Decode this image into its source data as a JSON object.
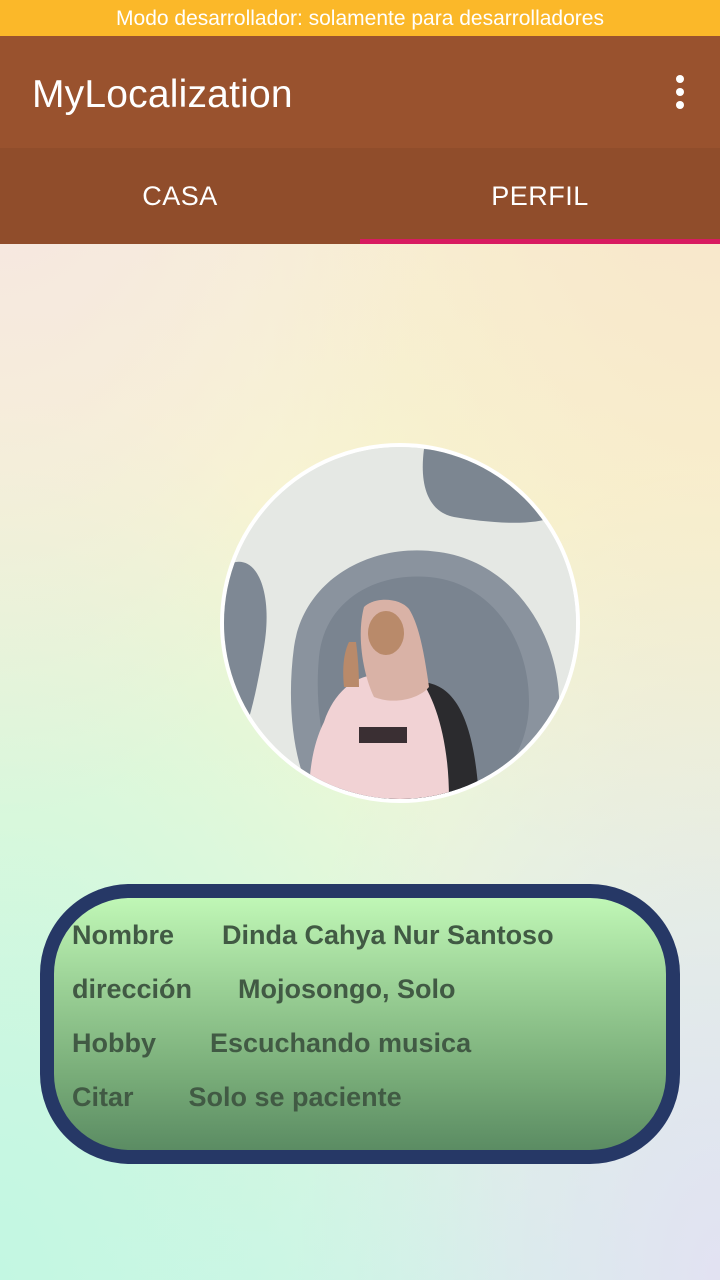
{
  "status_banner": "Modo desarrollador: solamente para desarrolladores",
  "appbar": {
    "title": "MyLocalization",
    "menu_icon": "more-vert-icon"
  },
  "tabs": [
    {
      "label": "CASA",
      "selected": false
    },
    {
      "label": "PERFIL",
      "selected": true
    }
  ],
  "profile": {
    "photo": "profile-photo",
    "rows": [
      {
        "label": "Nombre",
        "value": "Dinda Cahya Nur Santoso"
      },
      {
        "label": "dirección",
        "value": "Mojosongo, Solo"
      },
      {
        "label": "Hobby",
        "value": "Escuchando musica"
      },
      {
        "label": "Citar",
        "value": "Solo se paciente"
      }
    ]
  },
  "colors": {
    "banner": "#fbb829",
    "appbar": "#99522e",
    "tabbar": "#904d2b",
    "tab_indicator": "#d81b60",
    "card_border": "#263866",
    "card_text": "#415a44"
  }
}
